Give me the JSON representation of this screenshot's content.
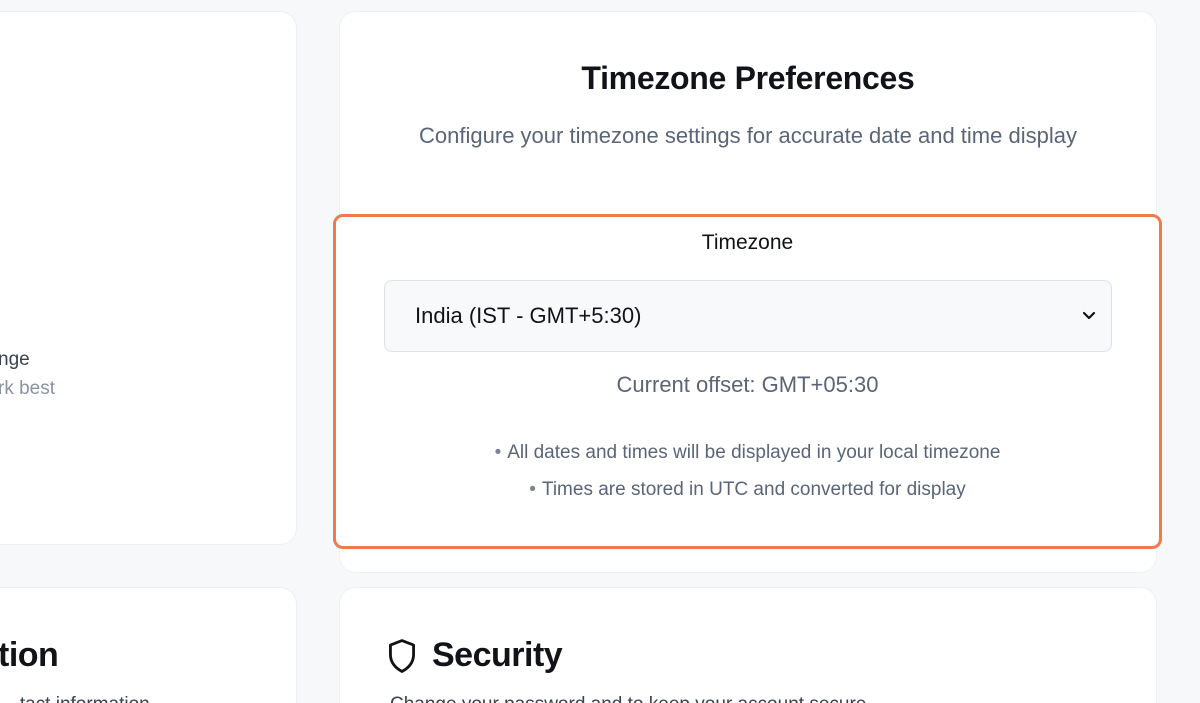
{
  "left_card": {
    "line1": "nge",
    "line2": "rk best"
  },
  "left_bottom_card": {
    "heading": "tion",
    "subtitle": "...tact information..."
  },
  "timezone_card": {
    "title": "Timezone Preferences",
    "description": "Configure your timezone settings for accurate date and time display",
    "field_label": "Timezone",
    "selected_value": "India (IST - GMT+5:30)",
    "current_offset": "Current offset: GMT+05:30",
    "notes": [
      "All dates and times will be displayed in your local timezone",
      "Times are stored in UTC and converted for display"
    ],
    "highlight_color": "#f07a4a"
  },
  "security_card": {
    "icon": "shield-icon",
    "title": "Security",
    "subtitle": "Change your password and to keep your account secure"
  }
}
